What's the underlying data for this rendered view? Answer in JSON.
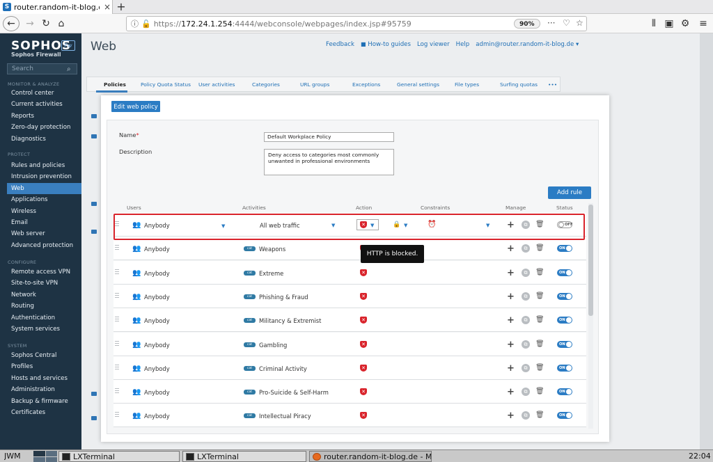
{
  "browser": {
    "tab_title": "router.random-it-blog.de",
    "tab_close": "×",
    "new_tab": "+",
    "url_prefix": "https://",
    "url_host": "172.24.1.254",
    "url_rest": ":4444/webconsole/webpages/index.jsp#95759",
    "zoom": "90%",
    "icons": [
      "back-icon",
      "forward-icon",
      "reload-icon",
      "home-icon",
      "info-icon",
      "lock-warning-icon",
      "more-icon",
      "pocket-icon",
      "bookmark-star-icon",
      "library-icon",
      "sidebar-icon",
      "extension-icon",
      "menu-icon"
    ]
  },
  "sidebar": {
    "logo": "SOPHOS",
    "logo_badge": "Fw",
    "logo_sub": "Sophos Firewall",
    "search_placeholder": "Search",
    "sections": [
      {
        "title": "MONITOR & ANALYZE",
        "items": [
          "Control center",
          "Current activities",
          "Reports",
          "Zero-day protection",
          "Diagnostics"
        ]
      },
      {
        "title": "PROTECT",
        "items": [
          "Rules and policies",
          "Intrusion prevention",
          "Web",
          "Applications",
          "Wireless",
          "Email",
          "Web server",
          "Advanced protection"
        ]
      },
      {
        "title": "CONFIGURE",
        "items": [
          "Remote access VPN",
          "Site-to-site VPN",
          "Network",
          "Routing",
          "Authentication",
          "System services"
        ]
      },
      {
        "title": "SYSTEM",
        "items": [
          "Sophos Central",
          "Profiles",
          "Hosts and services",
          "Administration",
          "Backup & firmware",
          "Certificates"
        ]
      }
    ],
    "active_item": "Web"
  },
  "header": {
    "title": "Web",
    "links": [
      "Feedback",
      "How-to guides",
      "Log viewer",
      "Help",
      "admin@router.random-it-blog.de ▾"
    ]
  },
  "subtabs": [
    "Policies",
    "Policy Quota Status",
    "User activities",
    "Categories",
    "URL groups",
    "Exceptions",
    "General settings",
    "File types",
    "Surfing quotas",
    "•••"
  ],
  "active_subtab": "Policies",
  "dialog": {
    "title": "Edit web policy",
    "name_label": "Name",
    "name_required": "*",
    "name_value": "Default Workplace Policy",
    "description_label": "Description",
    "description_value": "Deny access to categories most commonly\nunwanted in professional environments",
    "add_rule": "Add rule",
    "columns": [
      "Users",
      "Activities",
      "Action",
      "Constraints",
      "Manage",
      "Status"
    ],
    "rules": [
      {
        "user": "Anybody",
        "activity": "All web traffic",
        "category_tag": false,
        "status": "OFF",
        "enabled": false
      },
      {
        "user": "Anybody",
        "activity": "Weapons",
        "category_tag": true,
        "status": "ON",
        "enabled": true
      },
      {
        "user": "Anybody",
        "activity": "Extreme",
        "category_tag": true,
        "status": "ON",
        "enabled": true
      },
      {
        "user": "Anybody",
        "activity": "Phishing & Fraud",
        "category_tag": true,
        "status": "ON",
        "enabled": true
      },
      {
        "user": "Anybody",
        "activity": "Militancy & Extremist",
        "category_tag": true,
        "status": "ON",
        "enabled": true
      },
      {
        "user": "Anybody",
        "activity": "Gambling",
        "category_tag": true,
        "status": "ON",
        "enabled": true
      },
      {
        "user": "Anybody",
        "activity": "Criminal Activity",
        "category_tag": true,
        "status": "ON",
        "enabled": true
      },
      {
        "user": "Anybody",
        "activity": "Pro-Suicide & Self-Harm",
        "category_tag": true,
        "status": "ON",
        "enabled": true
      },
      {
        "user": "Anybody",
        "activity": "Intellectual Piracy",
        "category_tag": true,
        "status": "ON",
        "enabled": true
      }
    ],
    "category_tag_label": "cat",
    "tooltip": "HTTP is blocked."
  },
  "taskbar": {
    "wm": "JWM",
    "items": [
      "LXTerminal",
      "LXTerminal",
      "router.random-it-blog.de - Mo"
    ],
    "clock": "22:04"
  },
  "colors": {
    "sidebar_bg": "#1e3344",
    "accent": "#2b7cc4",
    "block_red": "#d9232b"
  }
}
